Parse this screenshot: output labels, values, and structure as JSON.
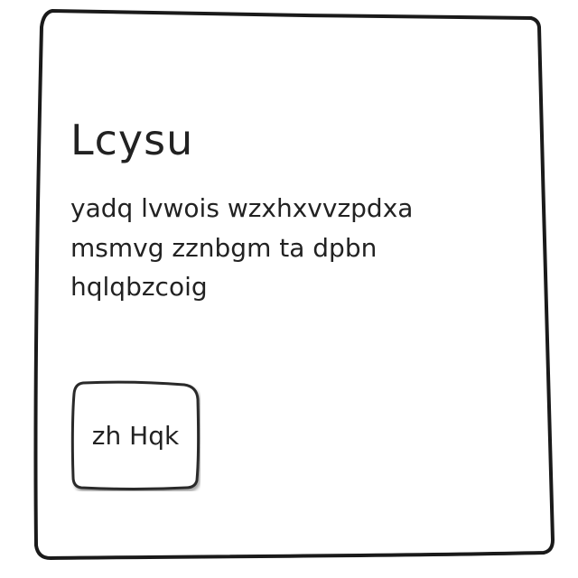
{
  "card": {
    "title": "Lcysu",
    "body": "yadq lvwois wzxhxvvzpdxa msmvg zznbgm ta dpbn hqlqbzcoig",
    "button_label": "zh Hqk"
  }
}
